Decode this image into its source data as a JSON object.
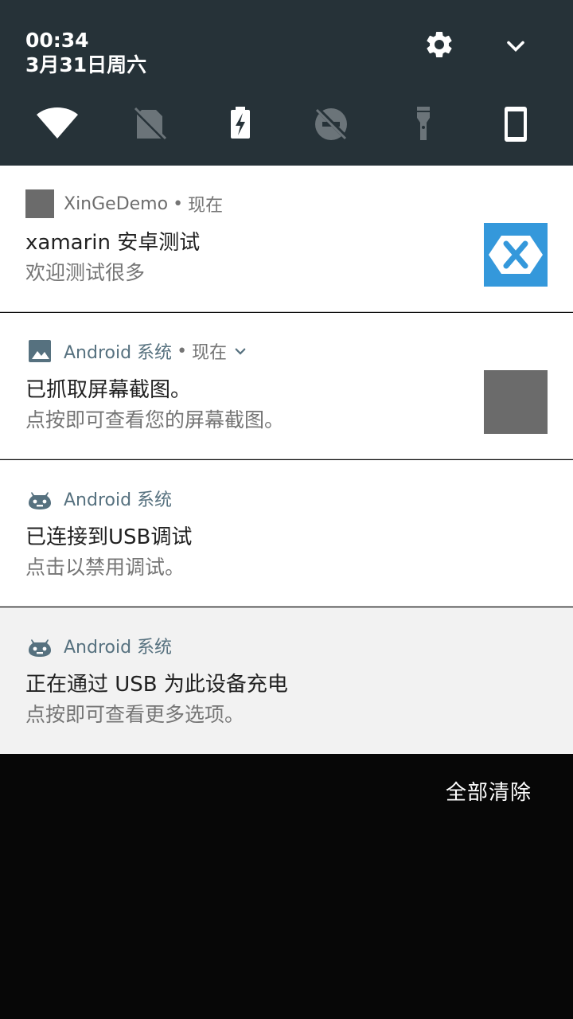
{
  "status": {
    "time": "00:34",
    "date": "3月31日周六"
  },
  "quick_settings": {
    "tiles": [
      {
        "icon": "wifi-icon"
      },
      {
        "icon": "sim-off-icon"
      },
      {
        "icon": "battery-charging-icon"
      },
      {
        "icon": "do-not-disturb-off-icon"
      },
      {
        "icon": "flashlight-off-icon"
      },
      {
        "icon": "phone-rotate-icon"
      }
    ]
  },
  "notifications": [
    {
      "app": "XinGeDemo",
      "separator": "•",
      "when": "现在",
      "title": "xamarin 安卓测试",
      "text": "欢迎测试很多"
    },
    {
      "app": "Android 系统",
      "separator": "•",
      "when": "现在",
      "title": "已抓取屏幕截图。",
      "text": "点按即可查看您的屏幕截图。"
    },
    {
      "app": "Android 系统",
      "title": "已连接到USB调试",
      "text": "点击以禁用调试。"
    },
    {
      "app": "Android 系统",
      "title": "正在通过 USB 为此设备充电",
      "text": "点按即可查看更多选项。"
    }
  ],
  "actions": {
    "clear_all": "全部清除"
  },
  "colors": {
    "header_bg": "#263238",
    "accent": "#56717f",
    "xamarin_blue": "#3498db"
  }
}
